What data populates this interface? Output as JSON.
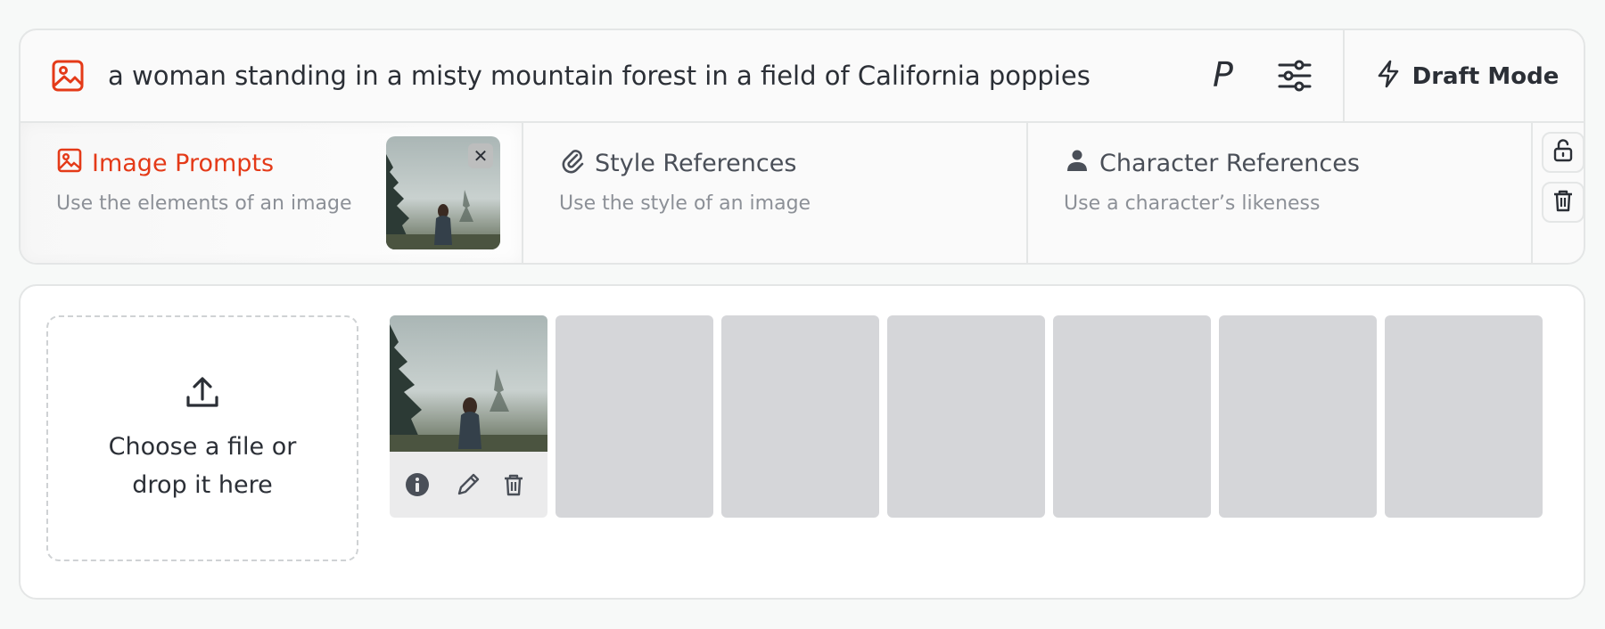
{
  "prompt": {
    "text": "a woman standing in a misty mountain forest in a field of California poppies",
    "param_glyph": "P",
    "draft_mode_label": "Draft Mode"
  },
  "references": [
    {
      "title": "Image Prompts",
      "subtitle": "Use the elements of an image",
      "icon": "image-icon",
      "active": true
    },
    {
      "title": "Style References",
      "subtitle": "Use the style of an image",
      "icon": "paperclip-icon",
      "active": false
    },
    {
      "title": "Character References",
      "subtitle": "Use a character’s likeness",
      "icon": "person-icon",
      "active": false
    }
  ],
  "thumb_close_glyph": "✕",
  "upload": {
    "label": "Choose a file or drop it here"
  },
  "colors": {
    "accent": "#e43a18",
    "border": "#e4e6e6",
    "slot_empty": "#d5d6d9"
  }
}
